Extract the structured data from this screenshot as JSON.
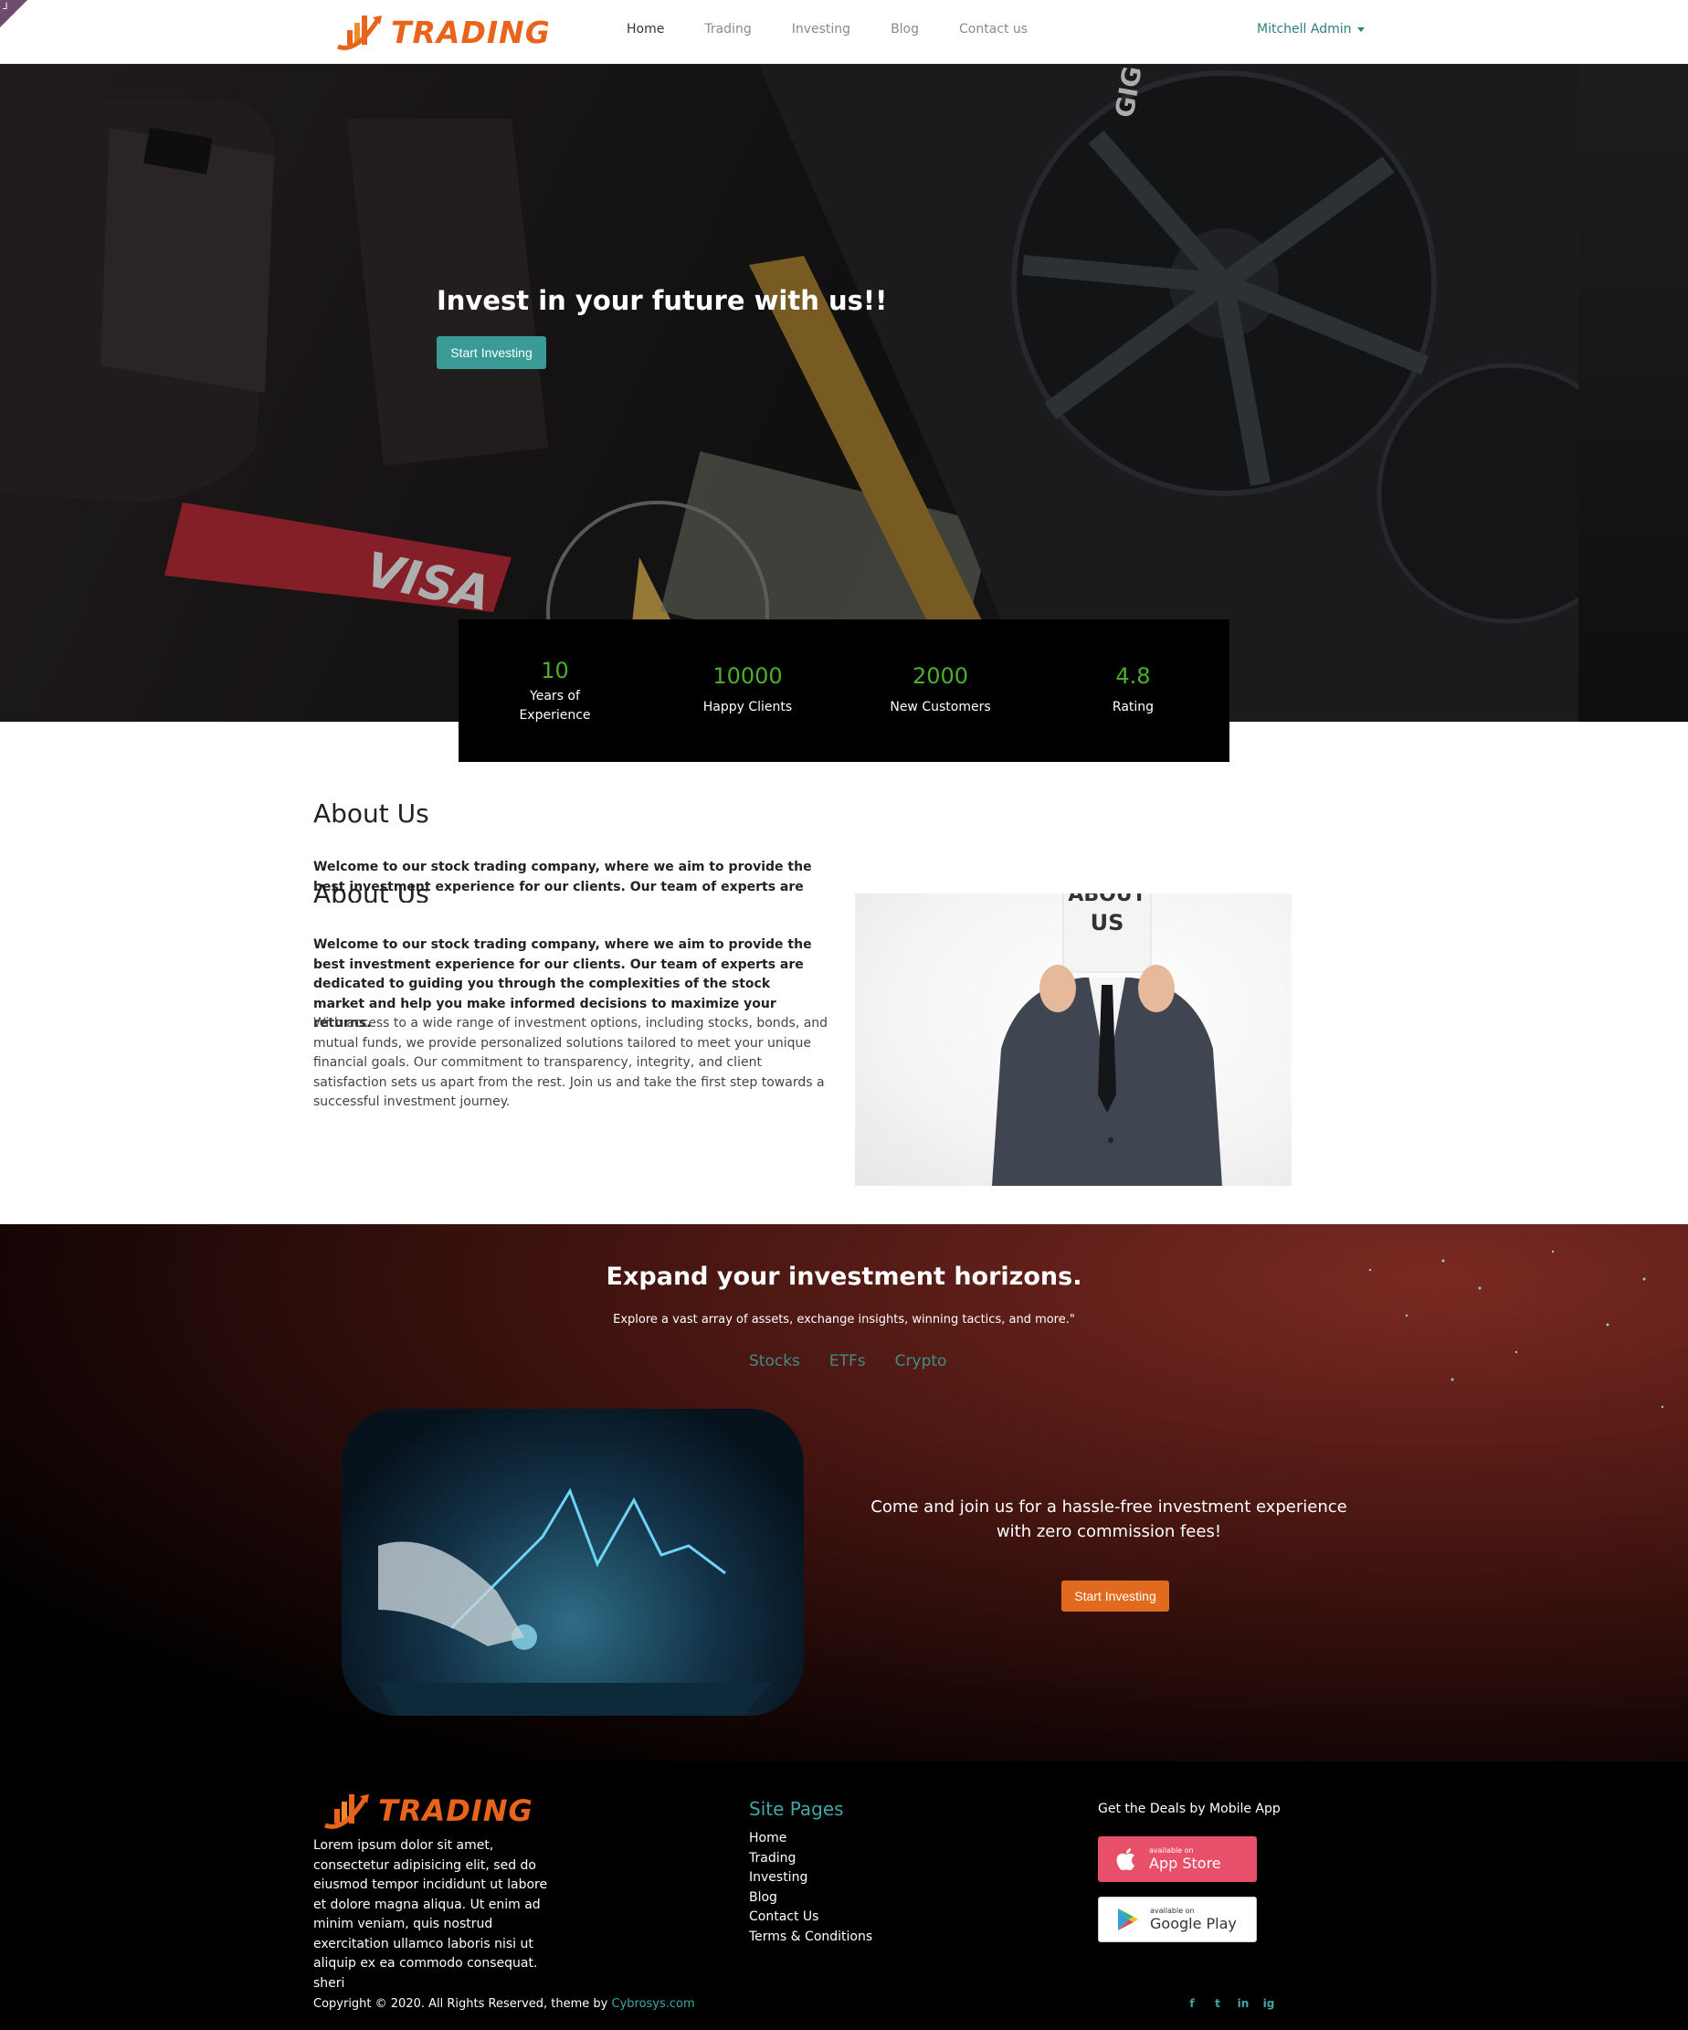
{
  "header": {
    "logo_text": "TRADING",
    "nav": [
      {
        "label": "Home",
        "active": true
      },
      {
        "label": "Trading",
        "active": false
      },
      {
        "label": "Investing",
        "active": false
      },
      {
        "label": "Blog",
        "active": false
      },
      {
        "label": "Contact us",
        "active": false
      }
    ],
    "user": "Mitchell Admin"
  },
  "hero": {
    "title": "Invest in your future with us!!",
    "button": "Start Investing"
  },
  "stats": [
    {
      "value": "10",
      "label": "Years of Experience"
    },
    {
      "value": "10000",
      "label": "Happy Clients"
    },
    {
      "value": "2000",
      "label": "New Customers"
    },
    {
      "value": "4.8",
      "label": "Rating"
    }
  ],
  "about": {
    "title": "About Us",
    "lead": "Welcome to our stock trading company, where we aim to provide the best investment experience for our clients. Our team of experts are dedicated to guiding you through the complexities of the stock market and help you make informed decisions to maximize your returns.",
    "body": "With access to a wide range of investment options, including stocks, bonds, and mutual funds, we provide personalized solutions tailored to meet your unique financial goals. Our commitment to transparency, integrity, and client satisfaction sets us apart from the rest. Join us and take the first step towards a successful investment journey.",
    "image_text_1": "ABOUT",
    "image_text_2": "US"
  },
  "expand": {
    "title": "Expand your investment horizons.",
    "subtitle": "Explore a vast array of assets, exchange insights, winning tactics, and more.\"",
    "tabs": [
      "Stocks",
      "ETFs",
      "Crypto"
    ],
    "join_text": "Come and join us for a hassle-free investment experience with zero commission fees!",
    "button": "Start Investing"
  },
  "footer": {
    "logo_text": "TRADING",
    "description": "Lorem ipsum dolor sit amet, consectetur adipisicing elit, sed do eiusmod tempor incididunt ut labore et dolore magna aliqua. Ut enim ad minim veniam, quis nostrud exercitation ullamco laboris nisi ut aliquip ex ea commodo consequat. sheri",
    "pages_title": "Site Pages",
    "pages": [
      "Home",
      "Trading",
      "Investing",
      "Blog",
      "Contact Us",
      "Terms & Conditions"
    ],
    "app_title": "Get the Deals by Mobile App",
    "app_store": {
      "small": "available on",
      "big": "App Store"
    },
    "google_play": {
      "small": "available on",
      "big": "Google Play"
    },
    "copyright": "Copyright © 2020. All Rights Reserved, theme by ",
    "copyright_brand": "Cybrosys.com",
    "social": [
      "f",
      "t",
      "in",
      "ig"
    ]
  },
  "colors": {
    "brand_orange": "#e8641b",
    "teal": "#3a9a96",
    "stat_green": "#4caf2a",
    "store_red": "#e8506a"
  }
}
